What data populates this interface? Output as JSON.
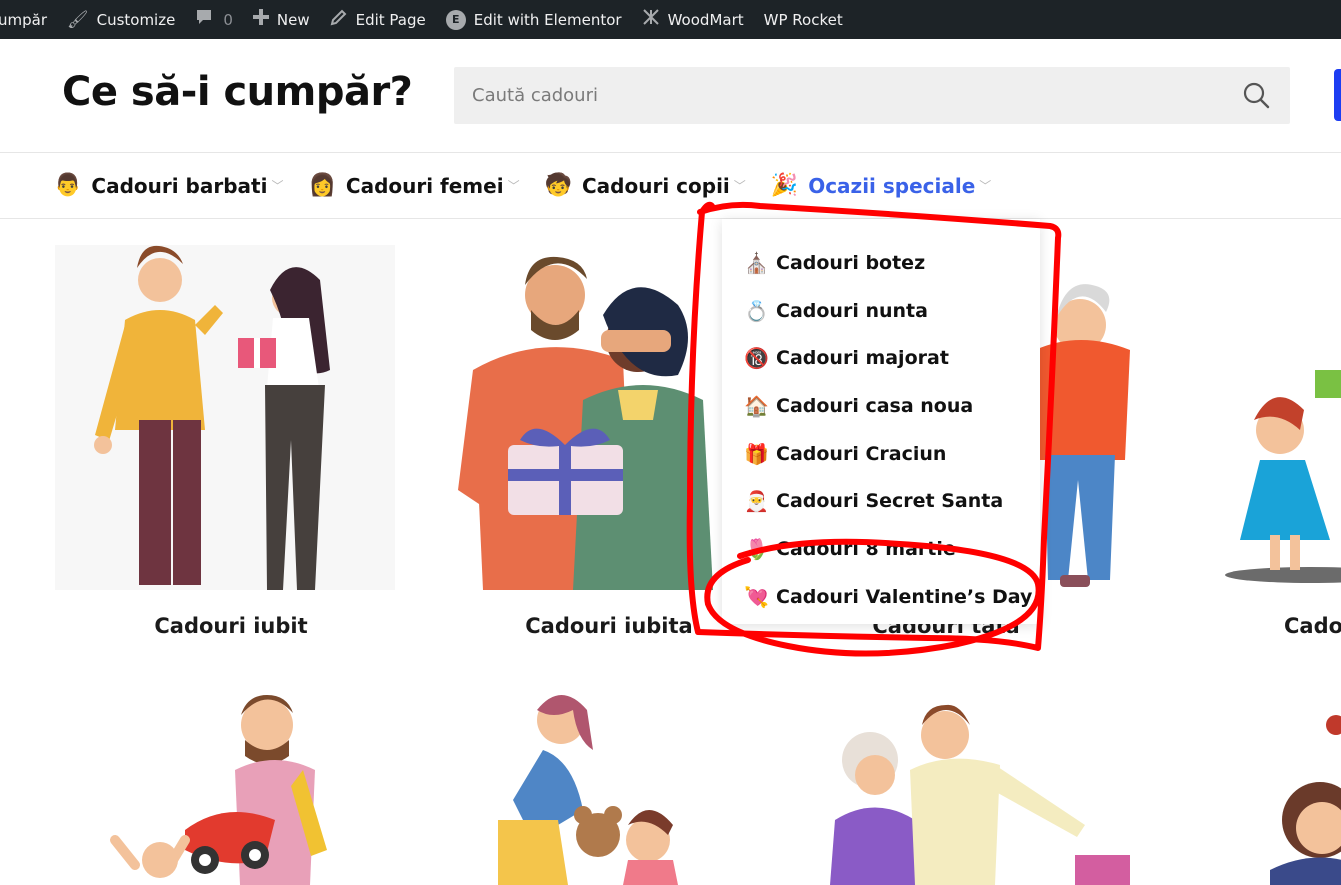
{
  "adminbar": {
    "site": "umpăr",
    "customize": "Customize",
    "comments_count": "0",
    "new": "New",
    "edit_page": "Edit Page",
    "elementor": "Edit with Elementor",
    "woodmart": "WoodMart",
    "wprocket": "WP Rocket"
  },
  "header": {
    "logo": "Ce să-i cumpăr?",
    "search_placeholder": "Caută cadouri"
  },
  "nav": {
    "items": [
      {
        "emoji": "👨",
        "label": "Cadouri barbati"
      },
      {
        "emoji": "👩",
        "label": "Cadouri femei"
      },
      {
        "emoji": "🧒",
        "label": "Cadouri copii"
      },
      {
        "emoji": "🎉",
        "label": "Ocazii speciale"
      }
    ]
  },
  "dropdown": {
    "items": [
      {
        "emoji": "⛪",
        "label": "Cadouri botez"
      },
      {
        "emoji": "💍",
        "label": "Cadouri nunta"
      },
      {
        "emoji": "🔞",
        "label": "Cadouri majorat"
      },
      {
        "emoji": "🏠",
        "label": "Cadouri casa noua"
      },
      {
        "emoji": "🎁",
        "label": "Cadouri Craciun"
      },
      {
        "emoji": "🎅",
        "label": "Cadouri Secret Santa"
      },
      {
        "emoji": "🌷",
        "label": "Cadouri 8 martie"
      },
      {
        "emoji": "💘",
        "label": "Cadouri Valentine’s Day"
      }
    ]
  },
  "cards": {
    "row1": [
      {
        "title": "Cadouri iubit"
      },
      {
        "title": "Cadouri iubita"
      },
      {
        "title": "Cadouri tata"
      },
      {
        "title": "Cado"
      }
    ]
  },
  "colors": {
    "accent_nav": "#3a62e8",
    "annotation": "#ff0000",
    "adminbar_bg": "#1d2327"
  }
}
